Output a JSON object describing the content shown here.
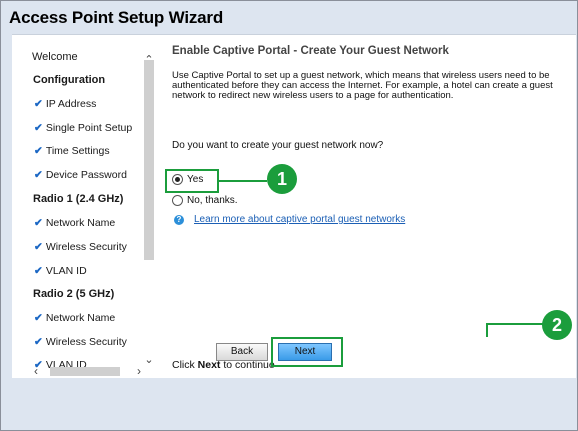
{
  "window": {
    "title": "Access Point Setup Wizard"
  },
  "nav": {
    "items": [
      {
        "label": "Welcome",
        "kind": "plain"
      },
      {
        "label": "Configuration",
        "kind": "section"
      },
      {
        "label": "IP Address",
        "kind": "check"
      },
      {
        "label": "Single Point Setup",
        "kind": "check"
      },
      {
        "label": "Time Settings",
        "kind": "check"
      },
      {
        "label": "Device Password",
        "kind": "check"
      },
      {
        "label": "Radio 1 (2.4 GHz)",
        "kind": "section"
      },
      {
        "label": "Network Name",
        "kind": "check"
      },
      {
        "label": "Wireless Security",
        "kind": "check"
      },
      {
        "label": "VLAN ID",
        "kind": "check"
      },
      {
        "label": "Radio 2 (5 GHz)",
        "kind": "section"
      },
      {
        "label": "Network Name",
        "kind": "check"
      },
      {
        "label": "Wireless Security",
        "kind": "check"
      },
      {
        "label": "VLAN ID",
        "kind": "check"
      }
    ]
  },
  "content": {
    "heading": "Enable Captive Portal - Create Your Guest Network",
    "description": "Use Captive Portal to set up a guest network, which means that wireless users need to be authenticated before they can access the Internet. For example, a hotel can create a guest network to redirect new wireless users to a page for authentication.",
    "question": "Do you want to create your guest network now?",
    "option_yes": "Yes",
    "option_no": "No, thanks.",
    "help_link": "Learn more about captive portal guest networks",
    "continue_prefix": "Click ",
    "continue_bold": "Next",
    "continue_suffix": " to continue"
  },
  "buttons": {
    "back": "Back",
    "next": "Next"
  },
  "callouts": {
    "one": "1",
    "two": "2"
  },
  "colors": {
    "accent_green": "#1b9d3c",
    "link_blue": "#1b5fb5",
    "check_blue": "#1b67c4"
  }
}
